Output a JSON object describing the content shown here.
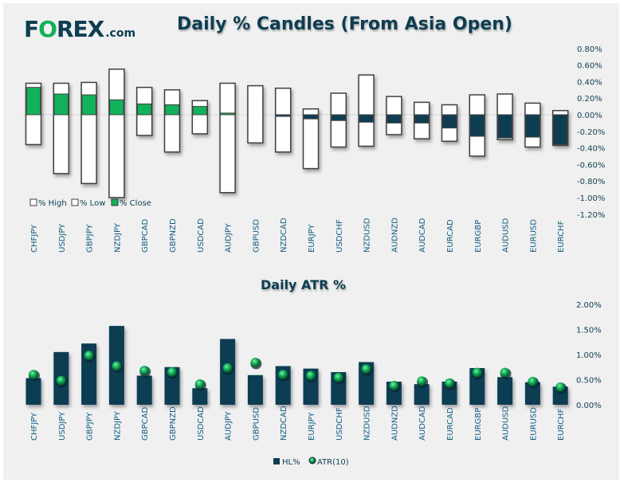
{
  "brand": {
    "logo_prefix": "F",
    "logo_o": "O",
    "logo_suffix": "REX",
    "logo_domain": ".com"
  },
  "colors": {
    "navy": "#0e3d52",
    "green": "#12b25a",
    "white": "#ffffff",
    "background": "#f0f0f0"
  },
  "chart_data": [
    {
      "type": "candlestick-bar",
      "title": "Daily % Candles (From Asia Open)",
      "xlabel": "",
      "ylabel": "",
      "ylim": [
        -1.2,
        0.8
      ],
      "yticks": [
        "0.80%",
        "0.60%",
        "0.40%",
        "0.20%",
        "0.00%",
        "-0.20%",
        "-0.40%",
        "-0.60%",
        "-0.80%",
        "-1.00%",
        "-1.20%"
      ],
      "ytick_values": [
        0.8,
        0.6,
        0.4,
        0.2,
        0.0,
        -0.2,
        -0.4,
        -0.6,
        -0.8,
        -1.0,
        -1.2
      ],
      "legend": [
        "% High",
        "% Low",
        "% Close"
      ],
      "legend_position": "bottom-left",
      "categories": [
        "CHFJPY",
        "USDJPY",
        "GBPJPY",
        "NZDJPY",
        "GBPCAD",
        "GBPNZD",
        "USDCAD",
        "AUDJPY",
        "GBPUSD",
        "NZDCAD",
        "EURJPY",
        "USDCHF",
        "NZDUSD",
        "AUDNZD",
        "AUDCAD",
        "EURCAD",
        "EURGBP",
        "AUDUSD",
        "EURUSD",
        "EURCHF"
      ],
      "series": [
        {
          "name": "% High",
          "values": [
            0.38,
            0.38,
            0.39,
            0.55,
            0.33,
            0.3,
            0.17,
            0.38,
            0.35,
            0.32,
            0.07,
            0.26,
            0.48,
            0.22,
            0.15,
            0.12,
            0.24,
            0.25,
            0.14,
            0.05
          ]
        },
        {
          "name": "% Low",
          "values": [
            -0.36,
            -0.71,
            -0.83,
            -1.0,
            -0.25,
            -0.45,
            -0.23,
            -0.94,
            -0.34,
            -0.45,
            -0.65,
            -0.39,
            -0.38,
            -0.24,
            -0.29,
            -0.32,
            -0.5,
            -0.3,
            -0.39,
            -0.37
          ]
        },
        {
          "name": "% Close",
          "values": [
            0.33,
            0.25,
            0.24,
            0.18,
            0.13,
            0.12,
            0.1,
            0.02,
            0.0,
            -0.02,
            -0.05,
            -0.07,
            -0.09,
            -0.1,
            -0.1,
            -0.16,
            -0.26,
            -0.28,
            -0.27,
            -0.36
          ]
        }
      ]
    },
    {
      "type": "bar",
      "title": "Daily ATR %",
      "xlabel": "",
      "ylabel": "",
      "ylim": [
        0,
        2.0
      ],
      "yticks": [
        "2.00%",
        "1.50%",
        "1.00%",
        "0.50%",
        "0.00%"
      ],
      "ytick_values": [
        2.0,
        1.5,
        1.0,
        0.5,
        0.0
      ],
      "legend": [
        "HL%",
        "ATR(10)"
      ],
      "legend_position": "bottom",
      "categories": [
        "CHFJPY",
        "USDJPY",
        "GBPJPY",
        "NZDJPY",
        "GBPCAD",
        "GBPNZD",
        "USDCAD",
        "AUDJPY",
        "GBPUSD",
        "NZDCAD",
        "EURJPY",
        "USDCHF",
        "NZDUSD",
        "AUDNZD",
        "AUDCAD",
        "EURCAD",
        "EURGBP",
        "AUDUSD",
        "EURUSD",
        "EURCHF"
      ],
      "series": [
        {
          "name": "HL%",
          "values": [
            0.53,
            1.05,
            1.22,
            1.57,
            0.58,
            0.75,
            0.33,
            1.31,
            0.59,
            0.77,
            0.72,
            0.65,
            0.85,
            0.46,
            0.41,
            0.46,
            0.73,
            0.55,
            0.45,
            0.36
          ]
        },
        {
          "name": "ATR(10)",
          "values": [
            0.6,
            0.48,
            0.98,
            0.77,
            0.68,
            0.65,
            0.41,
            0.73,
            0.84,
            0.6,
            0.58,
            0.54,
            0.71,
            0.38,
            0.47,
            0.43,
            0.64,
            0.64,
            0.46,
            0.35
          ]
        }
      ]
    }
  ]
}
